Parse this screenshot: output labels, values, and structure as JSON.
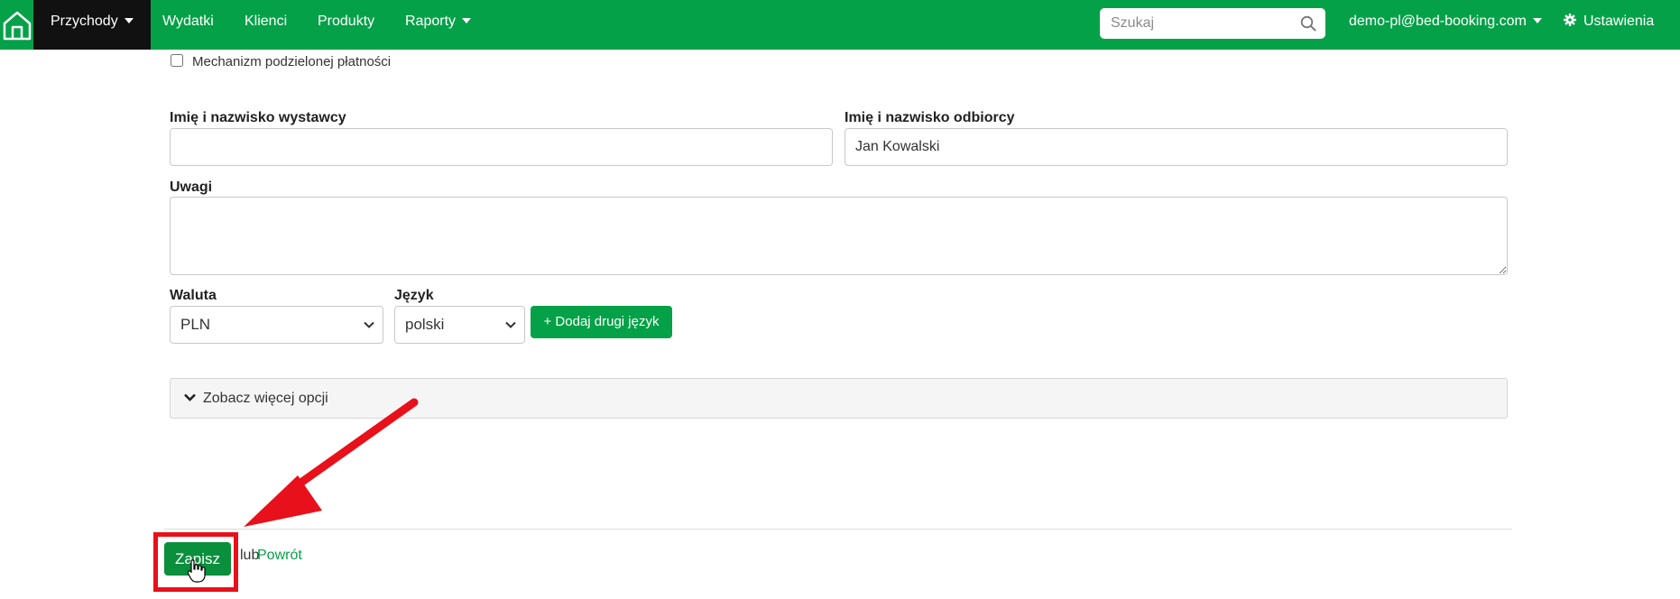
{
  "navbar": {
    "items": [
      {
        "label": "Przychody",
        "dropdown": true,
        "active": true
      },
      {
        "label": "Wydatki"
      },
      {
        "label": "Klienci"
      },
      {
        "label": "Produkty"
      },
      {
        "label": "Raporty",
        "dropdown": true
      }
    ],
    "search": {
      "placeholder": "Szukaj"
    },
    "user": {
      "label": "demo-pl@bed-booking.com"
    },
    "settings": {
      "label": "Ustawienia"
    }
  },
  "form": {
    "split_payment": {
      "label": "Mechanizm podzielonej płatności",
      "checked": false
    },
    "issuer": {
      "label": "Imię i nazwisko wystawcy",
      "value": ""
    },
    "recipient": {
      "label": "Imię i nazwisko odbiorcy",
      "value": "Jan Kowalski"
    },
    "notes": {
      "label": "Uwagi",
      "value": ""
    },
    "currency": {
      "label": "Waluta",
      "value": "PLN"
    },
    "language": {
      "label": "Język",
      "value": "polski"
    },
    "add_language": {
      "label": "+ Dodaj drugi język"
    },
    "more_options": {
      "label": "Zobacz więcej opcji"
    }
  },
  "footer": {
    "save": "Zapisz",
    "or": "lub",
    "back": "Powrót"
  },
  "colors": {
    "brand": "#05a148",
    "active_nav": "#111111",
    "annotation": "#e8101a"
  },
  "icons": [
    "home-icon",
    "search-icon",
    "gear-icon",
    "chevron-down-icon",
    "hand-cursor-icon"
  ]
}
